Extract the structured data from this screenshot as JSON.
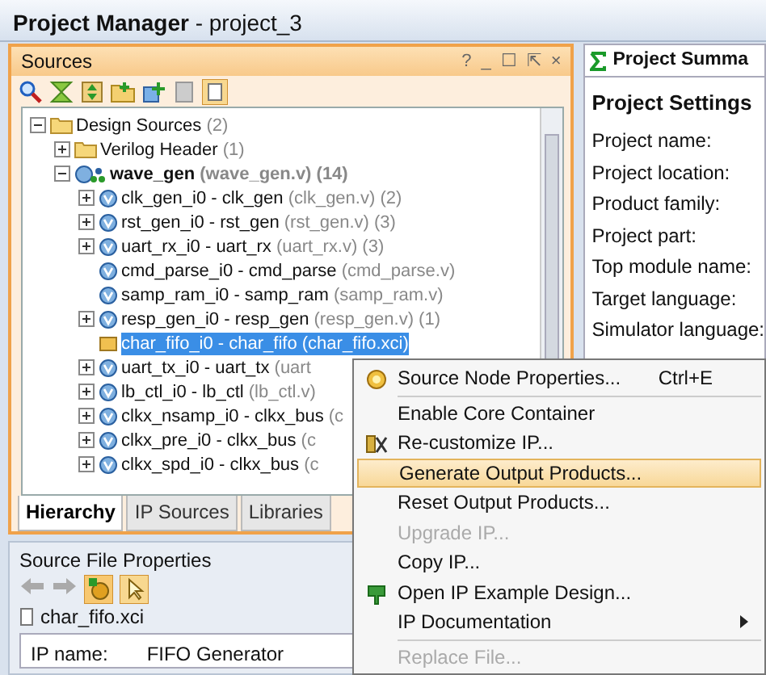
{
  "window": {
    "title": "**Project Manager** - project_3"
  },
  "sources_panel": {
    "title": "Sources",
    "controls": [
      "?",
      "_",
      "☐",
      "⇱",
      "×"
    ],
    "tree": [
      {
        "label": "Design Sources",
        "detail": "(2)",
        "kind": "folder",
        "expanded": true,
        "selected": false,
        "children": [
          {
            "label": "Verilog Header",
            "detail": "(1)",
            "kind": "folder",
            "expanded": false,
            "selected": false
          },
          {
            "label": "wave_gen",
            "detail": "(wave_gen.v) (14)",
            "kind": "top",
            "expanded": true,
            "selected": false,
            "children": [
              {
                "label": "clk_gen_i0 - clk_gen",
                "detail": "(clk_gen.v) (2)",
                "kind": "verilog",
                "expanded": false,
                "selected": false
              },
              {
                "label": "rst_gen_i0 - rst_gen",
                "detail": "(rst_gen.v) (3)",
                "kind": "verilog",
                "expanded": false,
                "selected": false
              },
              {
                "label": "uart_rx_i0 - uart_rx",
                "detail": "(uart_rx.v) (3)",
                "kind": "verilog",
                "expanded": false,
                "selected": false
              },
              {
                "label": "cmd_parse_i0 - cmd_parse",
                "detail": "(cmd_parse.v)",
                "kind": "verilog",
                "selected": false
              },
              {
                "label": "samp_ram_i0 - samp_ram",
                "detail": "(samp_ram.v)",
                "kind": "verilog",
                "selected": false
              },
              {
                "label": "resp_gen_i0 - resp_gen",
                "detail": "(resp_gen.v) (1)",
                "kind": "verilog",
                "expanded": false,
                "selected": false
              },
              {
                "label": "char_fifo_i0 - char_fifo",
                "detail": "(char_fifo.xci)",
                "kind": "ip",
                "selected": true
              },
              {
                "label": "uart_tx_i0 - uart_tx",
                "detail": "(uart",
                "kind": "verilog",
                "expanded": false,
                "selected": false
              },
              {
                "label": "lb_ctl_i0 - lb_ctl",
                "detail": "(lb_ctl.v)",
                "kind": "verilog",
                "expanded": false,
                "selected": false
              },
              {
                "label": "clkx_nsamp_i0 - clkx_bus",
                "detail": "(c",
                "kind": "verilog",
                "expanded": false,
                "selected": false
              },
              {
                "label": "clkx_pre_i0 - clkx_bus",
                "detail": "(c",
                "kind": "verilog",
                "expanded": false,
                "selected": false
              },
              {
                "label": "clkx_spd_i0 - clkx_bus",
                "detail": "(c",
                "kind": "verilog",
                "expanded": false,
                "selected": false
              }
            ]
          }
        ]
      }
    ],
    "tabs": [
      {
        "label": "Hierarchy",
        "selected": true
      },
      {
        "label": "IP Sources",
        "selected": false
      },
      {
        "label": "Libraries",
        "selected": false
      }
    ]
  },
  "properties_panel": {
    "title": "Source File Properties",
    "file": "char_fifo.xci",
    "fields": [
      {
        "label": "IP name:",
        "value": "FIFO Generator"
      }
    ]
  },
  "summary_panel": {
    "tab": "Project Summa",
    "section": "Project Settings",
    "labels": [
      "Project name:",
      "Project location:",
      "Product family:",
      "Project part:",
      "Top module name:",
      "Target language:",
      "Simulator language:"
    ]
  },
  "context_menu": [
    {
      "kind": "item",
      "label": "Source Node Properties...",
      "shortcut": "Ctrl+E",
      "disabled": false,
      "selected": false
    },
    {
      "kind": "separator"
    },
    {
      "kind": "item",
      "label": "Enable Core Container",
      "disabled": false,
      "selected": false
    },
    {
      "kind": "item",
      "label": "Re-customize IP...",
      "disabled": false,
      "selected": false
    },
    {
      "kind": "item",
      "label": "Generate Output Products...",
      "disabled": false,
      "selected": true
    },
    {
      "kind": "item",
      "label": "Reset Output Products...",
      "disabled": false,
      "selected": false
    },
    {
      "kind": "item",
      "label": "Upgrade IP...",
      "disabled": true,
      "selected": false
    },
    {
      "kind": "item",
      "label": "Copy IP...",
      "disabled": false,
      "selected": false
    },
    {
      "kind": "item",
      "label": "Open IP Example Design...",
      "disabled": false,
      "selected": false
    },
    {
      "kind": "item",
      "label": "IP Documentation",
      "submenu": true,
      "disabled": false,
      "selected": false
    },
    {
      "kind": "separator"
    },
    {
      "kind": "item",
      "label": "Replace File...",
      "disabled": true,
      "selected": false
    }
  ]
}
